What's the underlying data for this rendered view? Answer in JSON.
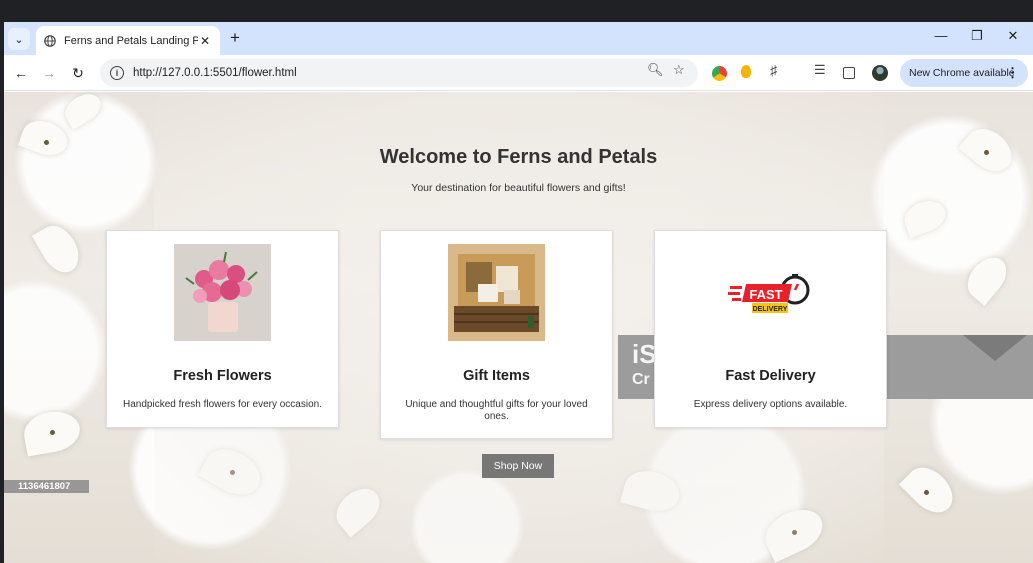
{
  "browser": {
    "tab_title": "Ferns and Petals Landing Page",
    "url": "http://127.0.0.1:5501/flower.html",
    "update_label": "New Chrome available",
    "icons": {
      "tab_search": "chevron-down-icon",
      "favicon": "globe-icon",
      "tab_close": "close-icon",
      "new_tab": "plus-icon",
      "minimize": "minimize-icon",
      "restore": "restore-icon",
      "close_window": "close-icon",
      "back": "back-arrow-icon",
      "forward": "forward-arrow-icon",
      "reload": "reload-icon",
      "site_info": "info-icon",
      "zoom": "zoom-icon",
      "bookmark": "star-icon",
      "extensions": "puzzle-icon",
      "media": "media-control-icon",
      "side_panel": "side-panel-icon",
      "profile": "avatar-icon",
      "menu": "kebab-menu-icon"
    }
  },
  "page": {
    "title": "Welcome to Ferns and Petals",
    "subtitle": "Your destination for beautiful flowers and gifts!",
    "cards": [
      {
        "title": "Fresh Flowers",
        "description": "Handpicked fresh flowers for every occasion."
      },
      {
        "title": "Gift Items",
        "description": "Unique and thoughtful gifts for your loved ones."
      },
      {
        "title": "Fast Delivery",
        "description": "Express delivery options available."
      }
    ],
    "delivery_logo": {
      "main": "FAST",
      "sub": "DELIVERY"
    },
    "shop_button": "Shop Now",
    "background_watermark": {
      "big": "iS",
      "sub": "Cr",
      "id": "1136461807"
    }
  },
  "colors": {
    "tabstrip": "#d3e3fd",
    "button": "#777777",
    "logo_red": "#e8202a",
    "logo_yellow": "#f7c315"
  }
}
